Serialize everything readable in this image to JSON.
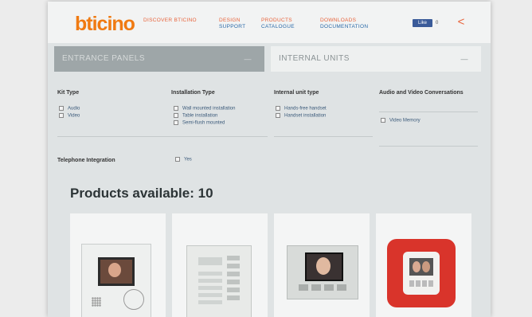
{
  "header": {
    "logo_brand": "bticino",
    "nav": [
      {
        "line1": "DISCOVER BTICINO",
        "line2": ""
      },
      {
        "line1": "DESIGN",
        "line2": "SUPPORT"
      },
      {
        "line1": "PRODUCTS",
        "line2": "CATALOGUE"
      },
      {
        "line1": "DOWNLOADS",
        "line2": "DOCUMENTATION"
      }
    ],
    "facebook_label": "Like",
    "facebook_count": "0"
  },
  "tabs": {
    "entrance": "ENTRANCE PANELS",
    "internal": "INTERNAL UNITS"
  },
  "filters": {
    "kit_type": {
      "heading": "Kit Type",
      "options": [
        "Audio",
        "Video"
      ]
    },
    "installation_type": {
      "heading": "Installation Type",
      "options": [
        "Wall mounted installation",
        "Table installation",
        "Semi-flush mounted"
      ]
    },
    "internal_unit_type": {
      "heading": "Internal unit type",
      "options": [
        "Hands-free handset",
        "Handset installation"
      ]
    },
    "audio_video": {
      "heading": "Audio and Video Conversations",
      "options": [
        "Video Memory"
      ]
    },
    "telephone": {
      "heading": "Telephone Integration",
      "option": "Yes"
    }
  },
  "products": {
    "title": "Products available: 10"
  },
  "colors": {
    "accent": "#f07a12",
    "link": "#2a6aa8",
    "red": "#d9342b"
  }
}
